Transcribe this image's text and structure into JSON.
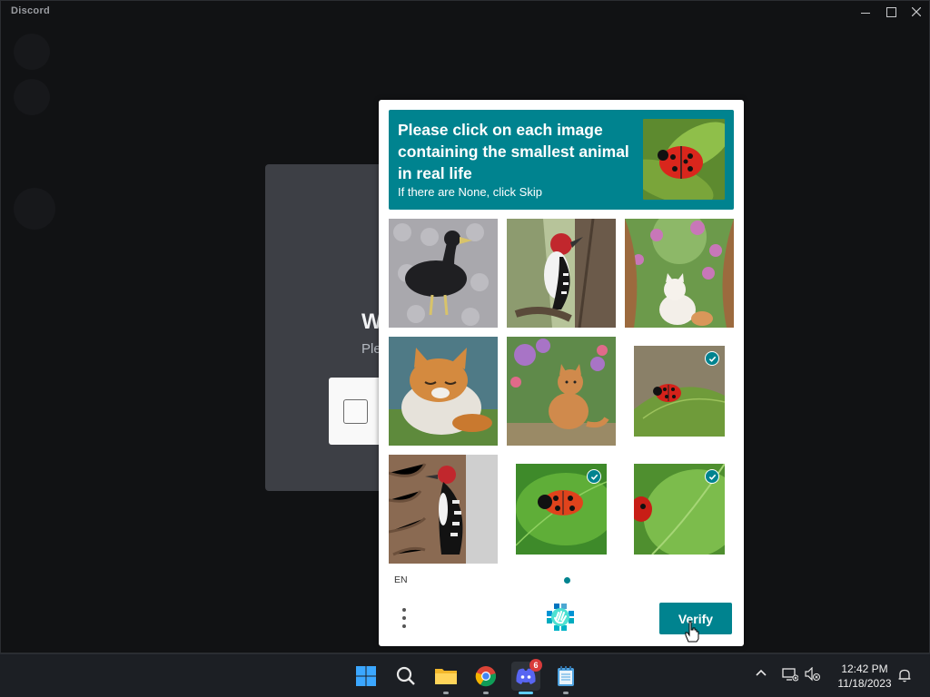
{
  "window": {
    "title": "Discord",
    "controls": [
      "minimize",
      "maximize",
      "close"
    ]
  },
  "background_card": {
    "welcome_fragment": "W",
    "please_fragment": "Ple"
  },
  "captcha": {
    "prompt_line": "Please click on each image containing the smallest animal in real life",
    "prompt_sub": "If there are None, click Skip",
    "prompt_image": "ladybug-on-leaf",
    "tiles": [
      {
        "subject": "black-duck",
        "selected": false
      },
      {
        "subject": "woodpecker-on-tree",
        "selected": false
      },
      {
        "subject": "cat-in-flower-garden",
        "selected": false
      },
      {
        "subject": "sleeping-orange-cat",
        "selected": false
      },
      {
        "subject": "orange-cat-in-garden",
        "selected": false
      },
      {
        "subject": "ladybug-on-leaf",
        "selected": true
      },
      {
        "subject": "woodpecker-on-bark",
        "selected": false
      },
      {
        "subject": "ladybug-on-green-leaf",
        "selected": true
      },
      {
        "subject": "ladybug-on-large-leaf",
        "selected": true
      }
    ],
    "language": "EN",
    "verify_label": "Verify",
    "menu_icon": "more-vertical-icon",
    "logo_icon": "hcaptcha-logo-icon"
  },
  "taskbar": {
    "apps": [
      {
        "name": "start",
        "icon": "windows-start-icon"
      },
      {
        "name": "search",
        "icon": "search-icon"
      },
      {
        "name": "file-explorer",
        "icon": "folder-icon"
      },
      {
        "name": "chrome",
        "icon": "chrome-icon"
      },
      {
        "name": "discord",
        "icon": "discord-icon",
        "badge": "6",
        "active": true
      },
      {
        "name": "notepad",
        "icon": "notepad-icon"
      }
    ],
    "time": "12:42 PM",
    "date": "11/18/2023"
  },
  "colors": {
    "accent": "#00838f",
    "window_bg": "#111214",
    "taskbar_bg": "#1c1f24"
  }
}
